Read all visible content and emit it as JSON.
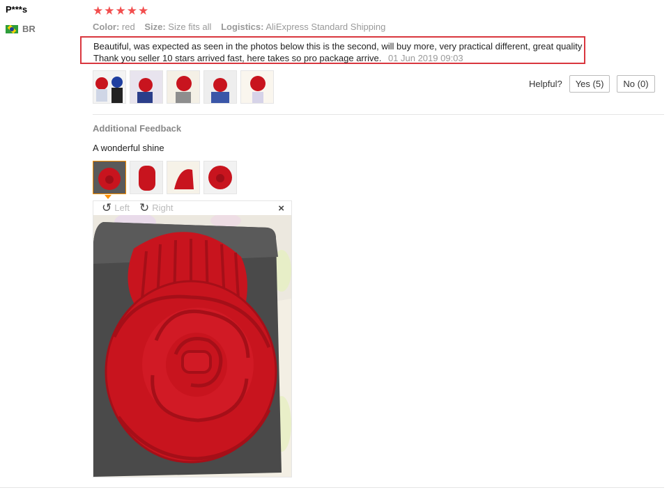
{
  "reviewer": {
    "name": "P***s",
    "country": "BR",
    "flag_icon": "brazil-flag-icon"
  },
  "review": {
    "rating": 5,
    "stars": [
      "★",
      "★",
      "★",
      "★",
      "★"
    ],
    "color_label": "Color:",
    "color_value": "red",
    "size_label": "Size:",
    "size_value": "Size fits all",
    "logistics_label": "Logistics:",
    "logistics_value": "AliExpress Standard Shipping",
    "text": "Beautiful, was expected as seen in the photos below this is the second, will buy more, very practical different, great quality Thank you seller 10 stars arrived fast, here takes so pro package arrive.",
    "date": "01 Jun 2019 09:03"
  },
  "helpful": {
    "label": "Helpful?",
    "yes": "Yes (5)",
    "no": "No (0)"
  },
  "additional": {
    "title": "Additional Feedback",
    "text": "A wonderful shine"
  },
  "viewer": {
    "left": "Left",
    "right": "Right",
    "close": "×",
    "rotate_left_icon": "↺",
    "rotate_right_icon": "↻"
  },
  "colors": {
    "accent": "#f24e4e",
    "highlight_border": "#d9363e",
    "selected_thumb": "#ff9000",
    "product": "#c8141e"
  }
}
